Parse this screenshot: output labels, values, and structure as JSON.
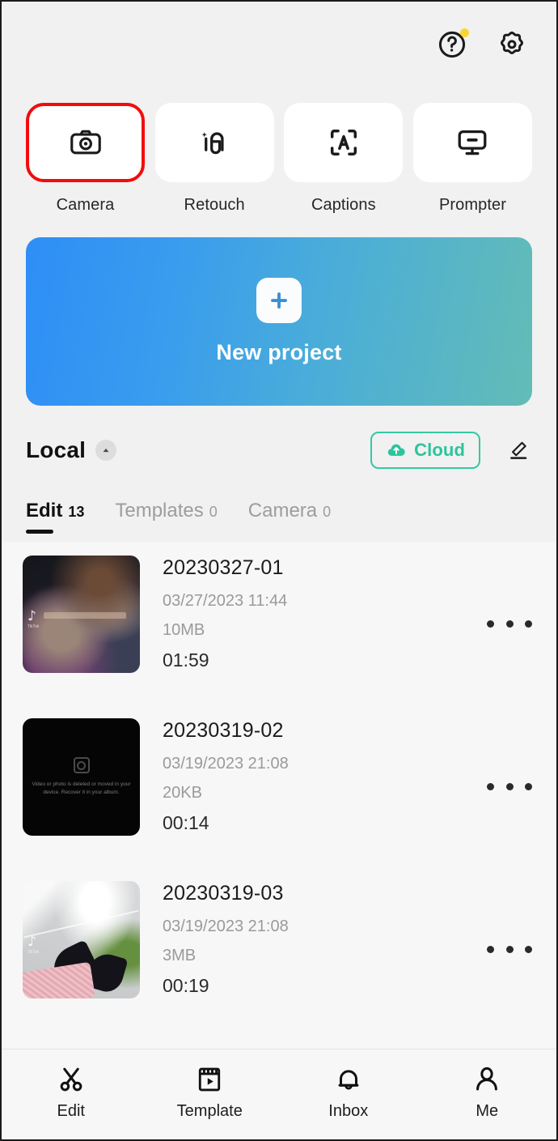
{
  "header": {
    "help_icon": "help-circle-icon",
    "settings_icon": "gear-icon",
    "notification_dot_color": "#fcd535"
  },
  "quick_actions": {
    "highlight_color": "#f20c0c",
    "items": [
      {
        "label": "Camera",
        "icon": "camera-icon",
        "highlighted": true
      },
      {
        "label": "Retouch",
        "icon": "retouch-icon",
        "highlighted": false
      },
      {
        "label": "Captions",
        "icon": "captions-icon",
        "highlighted": false
      },
      {
        "label": "Prompter",
        "icon": "prompter-icon",
        "highlighted": false
      }
    ]
  },
  "new_project": {
    "label": "New project",
    "plus_icon": "plus-icon",
    "gradient_start": "#2e8ef6",
    "gradient_end": "#63bcb6"
  },
  "storage": {
    "title": "Local",
    "chevron_icon": "chevron-up-icon",
    "cloud_label": "Cloud",
    "cloud_icon": "cloud-upload-icon",
    "cloud_color": "#2dc49d",
    "edit_icon": "pencil-icon"
  },
  "tabs": [
    {
      "label": "Edit",
      "count": "13",
      "active": true
    },
    {
      "label": "Templates",
      "count": "0",
      "active": false
    },
    {
      "label": "Camera",
      "count": "0",
      "active": false
    }
  ],
  "projects": [
    {
      "name": "20230327-01",
      "date": "03/27/2023 11:44",
      "size": "10MB",
      "duration": "01:59",
      "menu_icon": "more-options-icon",
      "thumbnail": "animated-movie-scene-with-tiktok-watermark",
      "watermark": "TikTok"
    },
    {
      "name": "20230319-02",
      "date": "03/19/2023 21:08",
      "size": "20KB",
      "duration": "00:14",
      "menu_icon": "more-options-icon",
      "thumbnail": "missing-media-placeholder",
      "placeholder_text": "Video or photo is deleted or moved in your device. Recover it in your album."
    },
    {
      "name": "20230319-03",
      "date": "03/19/2023 21:08",
      "size": "3MB",
      "duration": "00:19",
      "menu_icon": "more-options-icon",
      "thumbnail": "floor-tiles-with-black-shoes",
      "watermark": "TikTok"
    }
  ],
  "bottom_nav": [
    {
      "label": "Edit",
      "icon": "scissors-icon"
    },
    {
      "label": "Template",
      "icon": "template-card-icon"
    },
    {
      "label": "Inbox",
      "icon": "bell-icon"
    },
    {
      "label": "Me",
      "icon": "person-icon"
    }
  ]
}
